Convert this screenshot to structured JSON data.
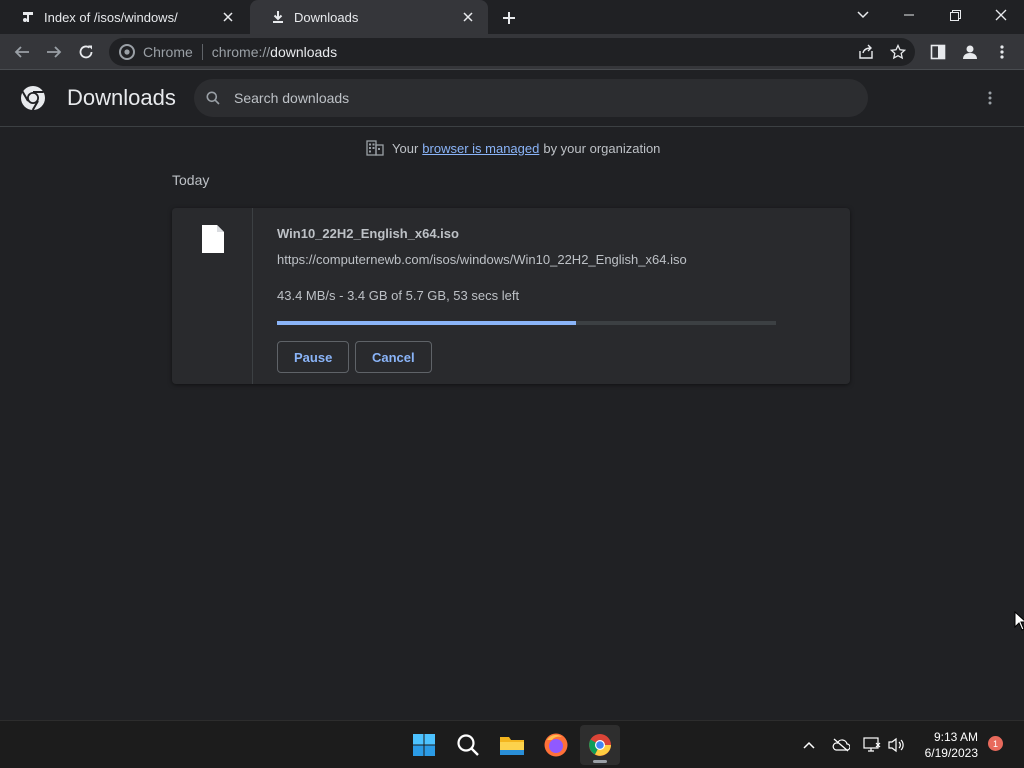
{
  "tabs": [
    {
      "title": "Index of /isos/windows/",
      "icon": "site-favicon"
    },
    {
      "title": "Downloads",
      "icon": "download-icon"
    }
  ],
  "omnibox": {
    "site_chip": "Chrome",
    "url_scheme": "chrome://",
    "url_host": "downloads"
  },
  "downloads_page": {
    "title": "Downloads",
    "search_placeholder": "Search downloads",
    "managed_notice": {
      "prefix": "Your",
      "link": "browser is managed",
      "suffix": "by your organization"
    },
    "section_label": "Today",
    "items": [
      {
        "file_name": "Win10_22H2_English_x64.iso",
        "url": "https://computernewb.com/isos/windows/Win10_22H2_English_x64.iso",
        "status": "43.4 MB/s - 3.4 GB of 5.7 GB, 53 secs left",
        "progress_fraction": 0.6,
        "pause_label": "Pause",
        "cancel_label": "Cancel"
      }
    ]
  },
  "taskbar": {
    "time": "9:13 AM",
    "date": "6/19/2023",
    "notification_count": "1",
    "apps": [
      "windows-start",
      "search",
      "file-explorer",
      "firefox",
      "chrome"
    ]
  },
  "colors": {
    "accent": "#8ab4f8",
    "background": "#202124",
    "toolbar": "#35363a",
    "card": "#292a2d"
  }
}
